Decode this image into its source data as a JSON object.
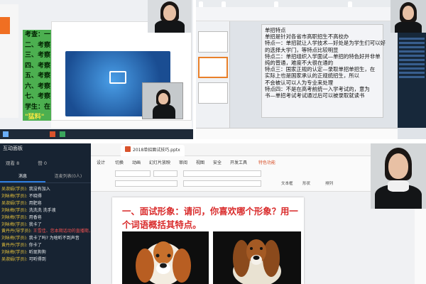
{
  "q1": {
    "slide_lines": [
      "考查：一",
      "二、考察",
      "三、考察",
      "四、考察",
      "五、考察",
      "六、考察",
      "七、考察",
      "学生：在",
      "\"猛料\""
    ],
    "window_header": [
      "",
      "",
      "",
      ""
    ],
    "share_caption": "",
    "toolbar_labels": [
      "",
      ""
    ]
  },
  "q2": {
    "tabs": [
      "",
      "",
      "",
      ""
    ],
    "thumb_texts": [
      "",
      "",
      ""
    ],
    "slide_lines": [
      "单招特点",
      "单招是针对各省市高职招生不高校办",
      "特点一：单招就让人学技术—好处是为学生们可以好",
      "           的选择大学门，等特点比较明显",
      "特点二：单招组织入学面试—单招的特色好并非单",
      "           纯的普通，难度不大很在通的",
      "特点三：国家正规的认定—录取单招单招生，在",
      "           实际上也是国家承认的正规统招生，所以",
      "           不会被认可以人为专业来处理",
      "特点四：不是在高考前统一入学考试的，意为",
      "           书—单招考试考试通过后可以被录取就读书"
    ],
    "search_text": "",
    "right_chat": ""
  },
  "q3": {
    "chat_panel": {
      "title": "互动面板",
      "viewers_label": "观看 8",
      "likes_label": "赞 0",
      "tabs": [
        "消息",
        "连麦列表(0人)"
      ],
      "messages": [
        {
          "who": "吴淑娟(学员):",
          "text": "我没有加入",
          "red": false
        },
        {
          "who": "刘咏梅(学员):",
          "text": "不晓得",
          "red": false
        },
        {
          "who": "吴淑娟(学员):",
          "text": "用肥皂",
          "red": false
        },
        {
          "who": "刘咏梅(学员):",
          "text": "洗洗洗  洗手液",
          "red": false
        },
        {
          "who": "刘咏梅(学员):",
          "text": "用香皂",
          "red": false
        },
        {
          "who": "刘咏梅(学员):",
          "text": "我卡了",
          "red": false
        },
        {
          "who": "黄丹丹(导学员):",
          "text": "王雪佳、您本期话动的直播期，为你点赞！",
          "red": true
        },
        {
          "who": "刘咏梅(学员):",
          "text": "我卡了吗?  为啥听不到声音",
          "red": false
        },
        {
          "who": "黄丹丹(学员):",
          "text": "你卡了",
          "red": false
        },
        {
          "who": "刘咏梅(学员):",
          "text": "听现狗狗",
          "red": false
        },
        {
          "who": "吴淑娟(学员):",
          "text": "可听得到",
          "red": false
        }
      ]
    },
    "file_tab": "2018单招面试技巧.pptx",
    "menus": [
      "设计",
      "切换",
      "动画",
      "幻灯片放映",
      "审阅",
      "视图",
      "安全",
      "开发工具",
      "特色功能"
    ],
    "toolbar_labels": [
      "文本框",
      "形状",
      "排列"
    ],
    "slide_title": "一、面试形象：请问，你喜欢哪个形象？用一个词语概括其特点。"
  }
}
